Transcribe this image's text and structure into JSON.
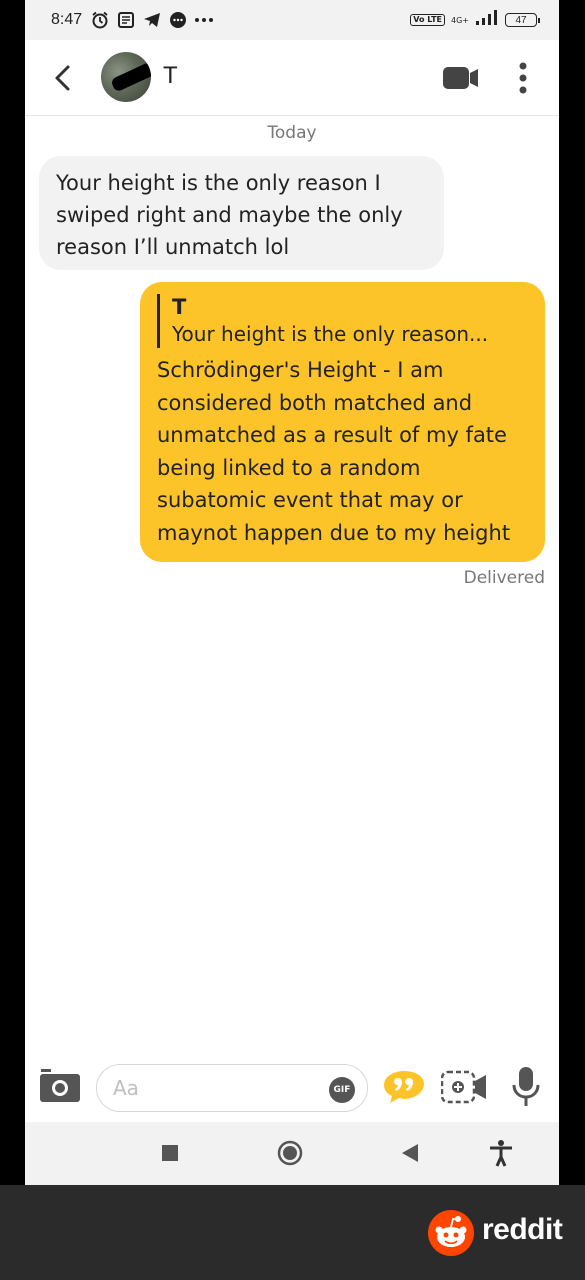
{
  "status_bar": {
    "time": "8:47",
    "lte_badge": "Vo LTE",
    "network": "4G+",
    "battery": "47"
  },
  "header": {
    "contact_name": "T"
  },
  "conversation": {
    "date_label": "Today",
    "incoming_message": "Your height is the only reason I swiped right and maybe the only reason I’ll unmatch lol",
    "outgoing_message": {
      "quote_author": "T",
      "quote_text": "Your height is the only reason...",
      "text": "Schrödinger's Height - I am considered both matched and unmatched as a result of my fate being linked to a random subatomic event that may or maynot happen due to my height"
    },
    "status": "Delivered"
  },
  "composer": {
    "placeholder": "Aa",
    "gif_label": "GIF"
  },
  "footer": {
    "brand": "reddit"
  },
  "colors": {
    "outgoing_bubble": "#fdc429",
    "incoming_bubble": "#f2f2f2",
    "reddit_orange": "#ff4500"
  }
}
